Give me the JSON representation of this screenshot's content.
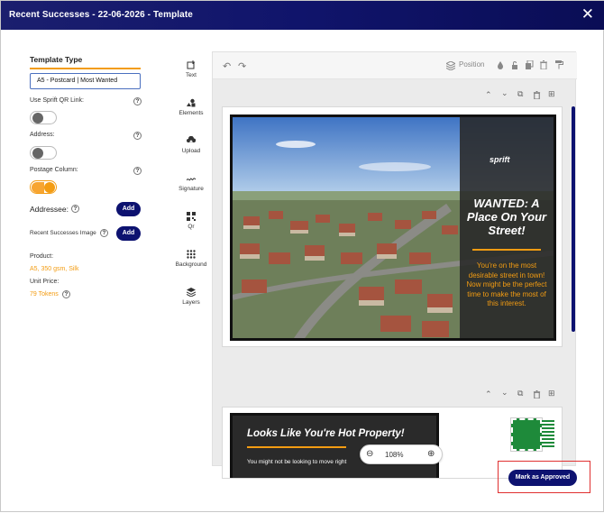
{
  "window": {
    "title": "Recent Successes - 22-06-2026 - Template",
    "close_symbol": "✕"
  },
  "left_panel": {
    "template_type_label": "Template Type",
    "template_type_value": "A5 - Postcard | Most Wanted",
    "options": [
      {
        "label": "Use Sprift QR Link:",
        "state": "off"
      },
      {
        "label": "Address:",
        "state": "off"
      },
      {
        "label": "Postage Column:",
        "state": "on"
      }
    ],
    "addressee_label": "Addressee:",
    "add_label": "Add",
    "recent_successes_label": "Recent Successes Image",
    "product_label": "Product:",
    "product_value": "A5, 350 gsm, Silk",
    "unit_price_label": "Unit Price:",
    "unit_price_value": "79 Tokens",
    "help_symbol": "?"
  },
  "tools": [
    {
      "label": "Text",
      "icon": "text-add-icon"
    },
    {
      "label": "Elements",
      "icon": "shapes-icon"
    },
    {
      "label": "Upload",
      "icon": "cloud-upload-icon"
    },
    {
      "label": "Signature",
      "icon": "signature-icon"
    },
    {
      "label": "Qr",
      "icon": "qr-icon"
    },
    {
      "label": "Background",
      "icon": "grid-dots-icon"
    },
    {
      "label": "Layers",
      "icon": "layers-icon"
    }
  ],
  "canvas_toolbar": {
    "undo_symbol": "↶",
    "redo_symbol": "↷",
    "position_label": "Position"
  },
  "page_controls": {
    "up": "⌃",
    "down": "⌄",
    "copy": "⧉",
    "delete": "🗑",
    "add": "⊞"
  },
  "front": {
    "brand": "sprift",
    "headline": "WANTED: A Place On Your Street!",
    "body": "You're on the most desirable street in town! Now might be the perfect time to make the most of this interest."
  },
  "back": {
    "headline": "Looks Like You're Hot Property!",
    "body": "You might not be looking to move right"
  },
  "zoom": {
    "value": "108%",
    "minus": "⊖",
    "plus": "⊕"
  },
  "actions": {
    "approve_label": "Mark as Approved"
  }
}
